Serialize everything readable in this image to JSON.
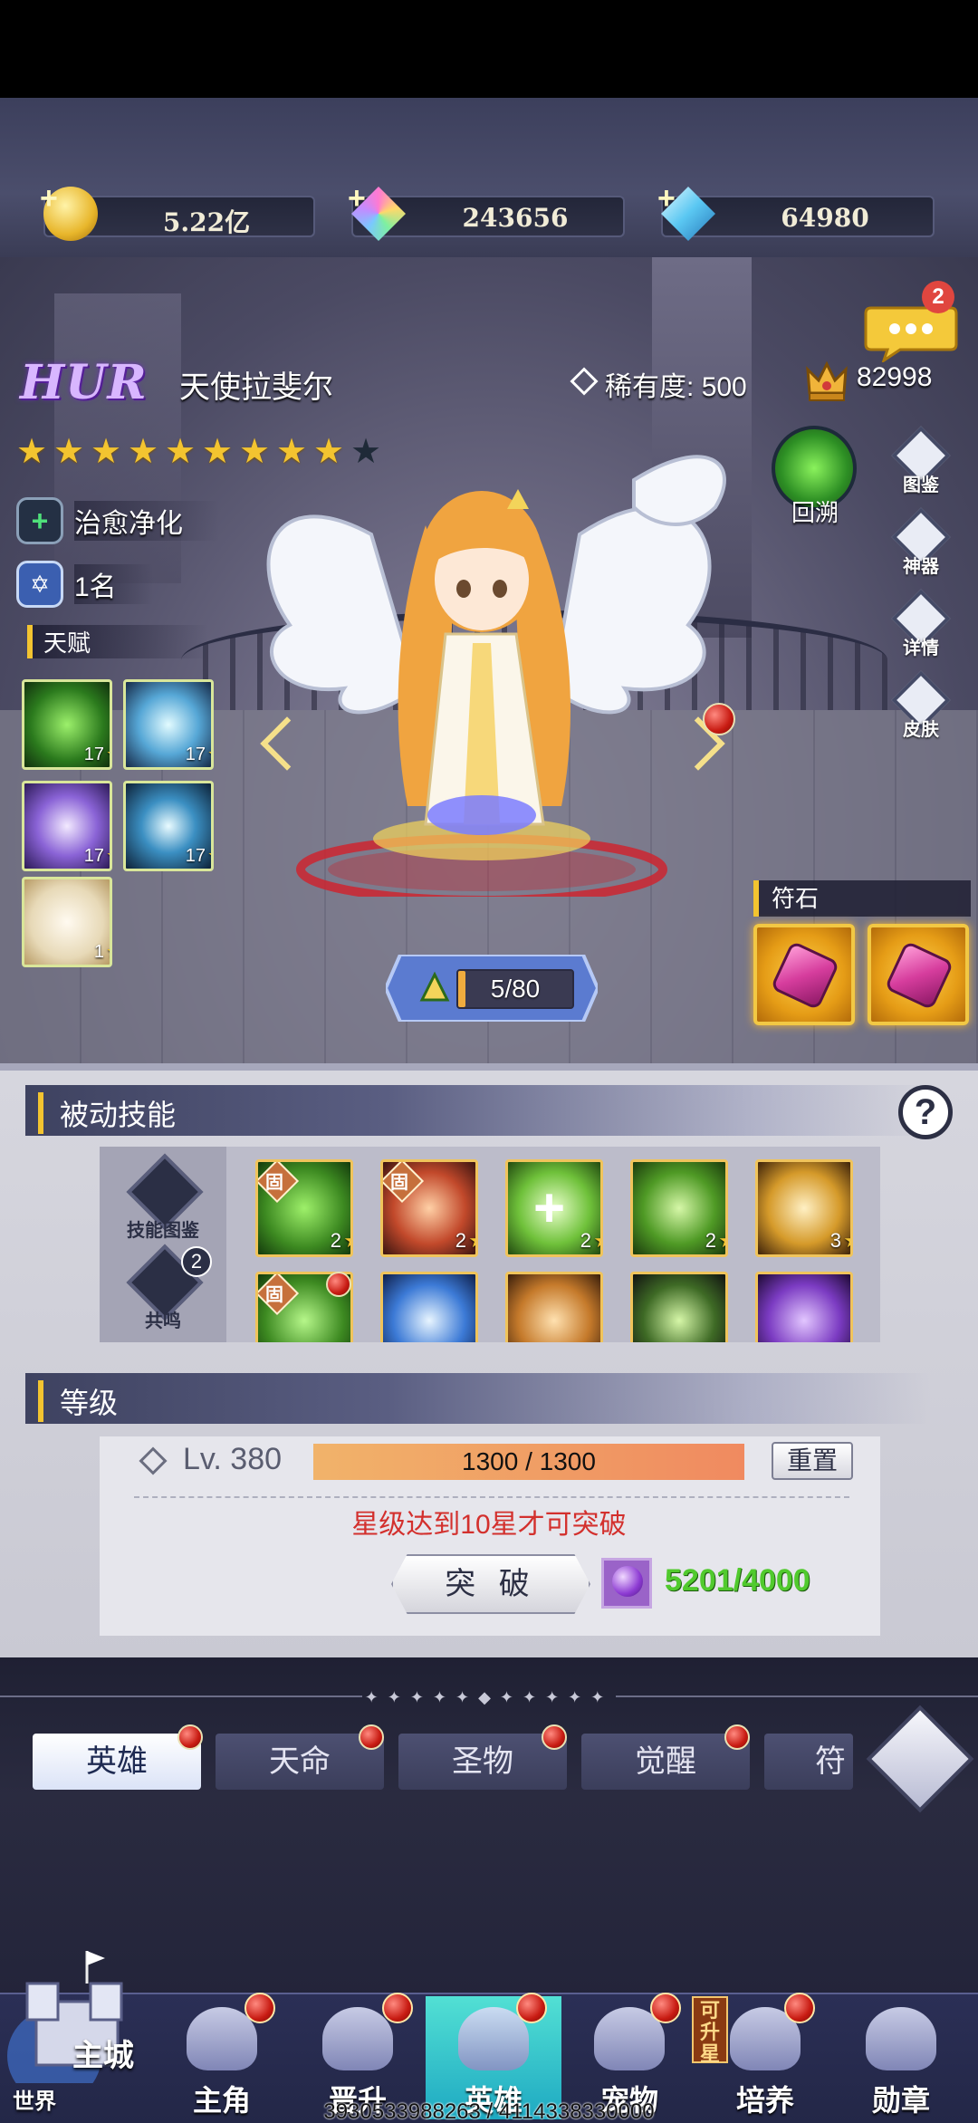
{
  "resources": [
    {
      "name": "gold",
      "value": "5.22亿"
    },
    {
      "name": "crystal",
      "value": "243656"
    },
    {
      "name": "diamond",
      "value": "64980"
    }
  ],
  "chat": {
    "badge": "2"
  },
  "hero": {
    "grade": "HUR",
    "name": "天使拉斐尔",
    "rarity_label": "稀有度:",
    "rarity_value": "500",
    "power": "82998",
    "stars_filled": 9,
    "stars_total": 10,
    "class": "治愈净化",
    "rank": "1名"
  },
  "talent": {
    "label": "天赋",
    "items": [
      {
        "icon": "green-tree-icon",
        "level": "17"
      },
      {
        "icon": "light-burst-icon",
        "level": "17"
      },
      {
        "icon": "purple-swirl-icon",
        "level": "17"
      },
      {
        "icon": "energy-orb-icon",
        "level": "17"
      },
      {
        "icon": "angel-gown-icon",
        "level": "1"
      }
    ]
  },
  "side_buttons": [
    {
      "name": "atlas",
      "label": "图鉴"
    },
    {
      "name": "artifact",
      "label": "神器"
    },
    {
      "name": "details",
      "label": "详情"
    },
    {
      "name": "skin",
      "label": "皮肤"
    }
  ],
  "retro": {
    "label": "回溯"
  },
  "exp": {
    "text": "5/80",
    "fraction": 0.0625
  },
  "runes": {
    "label": "符石"
  },
  "passive": {
    "title": "被动技能",
    "help": "?",
    "book_label": "技能图鉴",
    "resonance_label": "共鸣",
    "resonance_badge": "2",
    "fixed_mark": "固",
    "skills_row1": [
      {
        "icon": "bamboo-icon",
        "level": "2",
        "fixed": true
      },
      {
        "icon": "warrior-icon",
        "level": "2",
        "fixed": true
      },
      {
        "icon": "heal-cross-icon",
        "level": "2",
        "fixed": false
      },
      {
        "icon": "dancer-icon",
        "level": "2",
        "fixed": false
      },
      {
        "icon": "drum-icon",
        "level": "3",
        "fixed": false
      }
    ],
    "skills_row2": [
      {
        "icon": "leaf-icon",
        "fixed": true
      },
      {
        "icon": "phoenix-icon",
        "fixed": false
      },
      {
        "icon": "shield-icon",
        "fixed": false
      },
      {
        "icon": "shadow-icon",
        "fixed": false
      },
      {
        "icon": "dark-knight-icon",
        "fixed": false
      }
    ]
  },
  "level": {
    "title": "等级",
    "lv": "Lv. 380",
    "bar_text": "1300 / 1300",
    "bar_fraction": 1.0,
    "reset": "重置",
    "warning": "星级达到10星才可突破",
    "break_label": "突 破",
    "cost": "5201/4000"
  },
  "subtabs": [
    "英雄",
    "天命",
    "圣物",
    "觉醒",
    "符文"
  ],
  "nav": {
    "castle_label": "主城",
    "world_label": "世界",
    "items": [
      "主角",
      "晋升",
      "英雄",
      "宠物",
      "培养",
      "勋章"
    ],
    "upstar": "可升星"
  },
  "debug_text": "3930533988263 / 4114338330000",
  "colors": {
    "accent": "#f3c430",
    "danger": "#d3302d",
    "success": "#51ca2e"
  }
}
